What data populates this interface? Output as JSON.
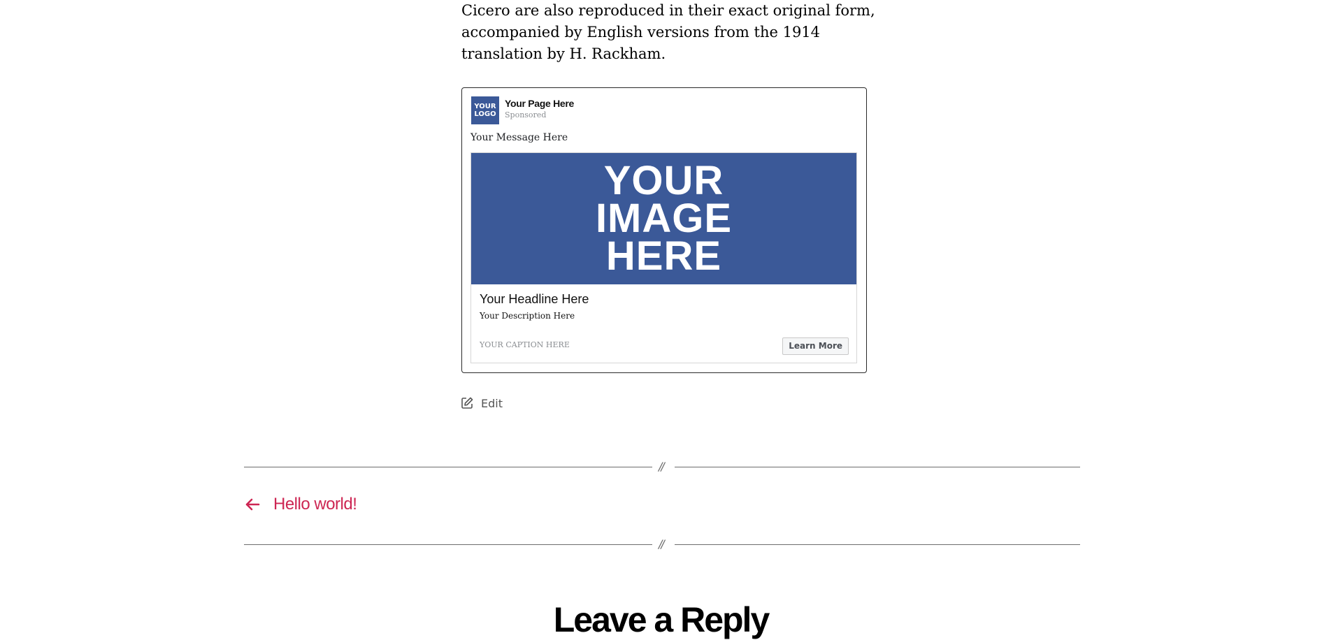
{
  "article": {
    "paragraph_lines": [
      "Cicero are also reproduced in their exact original form,",
      "accompanied by English versions from the 1914",
      "translation by H. Rackham."
    ]
  },
  "ad_preview": {
    "logo_line1": "YOUR",
    "logo_line2": "LOGO",
    "page_name": "Your Page Here",
    "sponsored": "Sponsored",
    "message": "Your Message Here",
    "image_line1": "YOUR",
    "image_line2": "IMAGE",
    "image_line3": "HERE",
    "headline": "Your Headline Here",
    "description": "Your Description Here",
    "caption": "YOUR CAPTION HERE",
    "cta_label": "Learn More",
    "brand_color": "#3b5998"
  },
  "edit": {
    "label": "Edit",
    "icon": "edit-icon"
  },
  "separator": {
    "mark": "//"
  },
  "navigation": {
    "prev_label": "Hello world!",
    "prev_icon": "arrow-left-icon",
    "accent_color": "#cd2653"
  },
  "comments": {
    "title": "Leave a Reply"
  }
}
